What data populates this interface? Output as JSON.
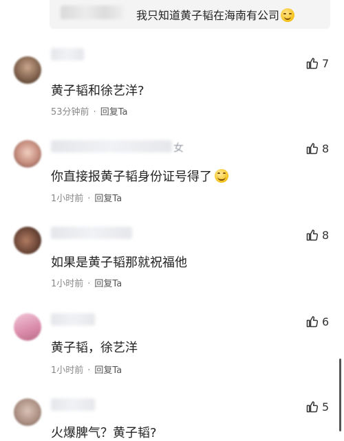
{
  "quote": {
    "text": "我只知道黄子韬在海南有公司",
    "emoji": "grinning-face-emoji"
  },
  "comments": [
    {
      "name_tail": "",
      "text": "黄子韬和徐艺洋?",
      "time": "53分钟前",
      "reply": "回复Ta",
      "likes": "7"
    },
    {
      "name_tail": "女",
      "text": "你直接报黄子韬身份证号得了",
      "time": "1小时前",
      "reply": "回复Ta",
      "likes": "8"
    },
    {
      "name_tail": "",
      "text": "如果是黄子韬那就祝福他",
      "time": "1小时前",
      "reply": "回复Ta",
      "likes": "8"
    },
    {
      "name_tail": "",
      "text": "黄子韬，徐艺洋",
      "time": "1小时前",
      "reply": "回复Ta",
      "likes": "6"
    },
    {
      "name_tail": "",
      "text": "火爆脾气？黄子韬?",
      "time": "",
      "reply": "",
      "likes": "5"
    }
  ],
  "meta_separator": "·",
  "icons": {
    "like": "thumbs-up-icon"
  },
  "colors": {
    "text": "#222222",
    "meta": "#888888",
    "quote_bg": "#f4f4f4"
  }
}
